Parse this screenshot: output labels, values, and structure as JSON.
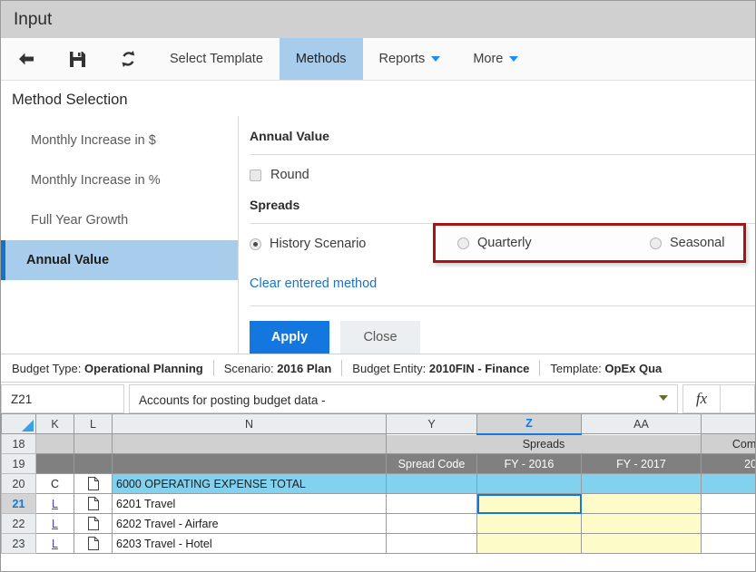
{
  "window": {
    "title": "Input"
  },
  "toolbar": {
    "icons": [
      {
        "name": "back-arrow-icon",
        "label": "Back"
      },
      {
        "name": "save-icon",
        "label": "Save"
      },
      {
        "name": "refresh-icon",
        "label": "Refresh"
      }
    ],
    "items": [
      {
        "label": "Select Template",
        "active": false,
        "caret": false
      },
      {
        "label": "Methods",
        "active": true,
        "caret": false
      },
      {
        "label": "Reports",
        "active": false,
        "caret": true
      },
      {
        "label": "More",
        "active": false,
        "caret": true
      }
    ]
  },
  "method_selection": {
    "title": "Method Selection",
    "items": [
      {
        "label": "Monthly Increase in $",
        "selected": false
      },
      {
        "label": "Monthly Increase in %",
        "selected": false
      },
      {
        "label": "Full Year Growth",
        "selected": false
      },
      {
        "label": "Annual Value",
        "selected": true
      }
    ],
    "detail": {
      "header": "Annual Value",
      "round_label": "Round",
      "round_checked": false,
      "spreads_label": "Spreads",
      "options": [
        {
          "label": "History Scenario",
          "selected": true
        },
        {
          "label": "Quarterly",
          "selected": false
        },
        {
          "label": "Seasonal",
          "selected": false
        }
      ],
      "clear_link": "Clear entered method",
      "apply_label": "Apply",
      "close_label": "Close",
      "highlight_color": "#a81313"
    }
  },
  "context_bar": [
    {
      "label": "Budget Type:",
      "value": "Operational Planning"
    },
    {
      "label": "Scenario:",
      "value": "2016 Plan"
    },
    {
      "label": "Budget Entity:",
      "value": "2010FIN - Finance"
    },
    {
      "label": "Template:",
      "value": "OpEx Qua"
    }
  ],
  "formula_bar": {
    "name_box": "Z21",
    "formula_text": "Accounts for posting budget data -",
    "fx_label": "fx"
  },
  "sheet": {
    "column_headers": [
      "K",
      "L",
      "N",
      "Y",
      "Z",
      "AA",
      ""
    ],
    "selected_column": "Z",
    "selected_cell": "Z21",
    "row_numbers": [
      "18",
      "19",
      "20",
      "21",
      "22",
      "23"
    ],
    "selected_row": "21",
    "group_band": {
      "spreads": "Spreads",
      "compare": "Compa"
    },
    "header_row": {
      "spread_code": "Spread Code",
      "fy_2016": "FY - 2016",
      "fy_2017": "FY - 2017",
      "compare": "20"
    },
    "rows": [
      {
        "num": "20",
        "k": "C",
        "doc": true,
        "n": "6000 OPERATING EXPENSE TOTAL",
        "style": "total"
      },
      {
        "num": "21",
        "k": "L",
        "doc": true,
        "n": "6201 Travel",
        "style": "data"
      },
      {
        "num": "22",
        "k": "L",
        "doc": true,
        "n": "6202 Travel - Airfare",
        "style": "data"
      },
      {
        "num": "23",
        "k": "L",
        "doc": true,
        "n": "6203 Travel - Hotel",
        "style": "data"
      }
    ]
  }
}
